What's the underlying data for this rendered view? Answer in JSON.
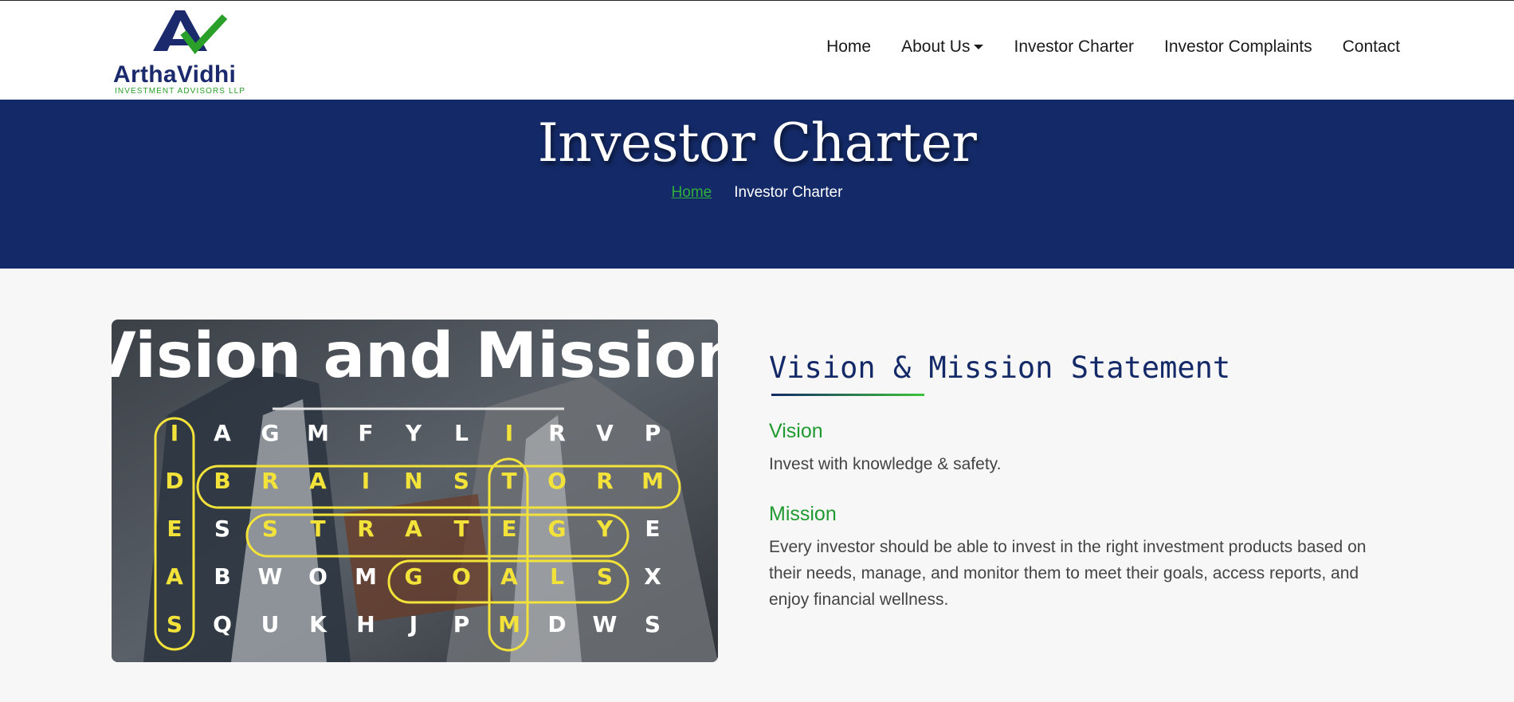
{
  "brand": {
    "name": "ArthaVidhi",
    "tagline": "INVESTMENT ADVISORS LLP",
    "colors": {
      "navy": "#142a68",
      "green": "#2fae3a"
    }
  },
  "nav": {
    "items": [
      {
        "label": "Home"
      },
      {
        "label": "About Us",
        "has_dropdown": true
      },
      {
        "label": "Investor Charter"
      },
      {
        "label": "Investor Complaints"
      },
      {
        "label": "Contact"
      }
    ]
  },
  "hero": {
    "title": "Investor Charter",
    "breadcrumb": {
      "home": "Home",
      "current": "Investor Charter"
    }
  },
  "content": {
    "image": {
      "heading": "Vision and Mission",
      "grid": [
        [
          "I",
          "A",
          "G",
          "M",
          "F",
          "Y",
          "L",
          "I",
          "R",
          "V",
          "P"
        ],
        [
          "D",
          "B",
          "R",
          "A",
          "I",
          "N",
          "S",
          "T",
          "O",
          "R",
          "M"
        ],
        [
          "E",
          "S",
          "S",
          "T",
          "R",
          "A",
          "T",
          "E",
          "G",
          "Y",
          "E"
        ],
        [
          "A",
          "B",
          "W",
          "O",
          "M",
          "G",
          "O",
          "A",
          "L",
          "S",
          "X"
        ],
        [
          "S",
          "Q",
          "U",
          "K",
          "H",
          "J",
          "P",
          "M",
          "D",
          "W",
          "S"
        ]
      ]
    },
    "section_title": "Vision & Mission Statement",
    "vision": {
      "heading": "Vision",
      "text": "Invest with knowledge & safety."
    },
    "mission": {
      "heading": "Mission",
      "text": "Every investor should be able to invest in the right investment products based on their needs, manage, and monitor them to meet their goals, access reports, and enjoy financial wellness."
    }
  }
}
